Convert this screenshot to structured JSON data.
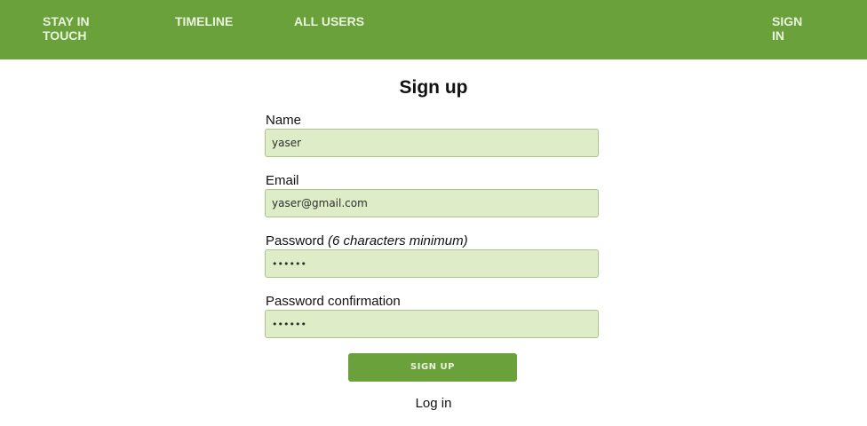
{
  "header": {
    "brand": "STAY IN TOUCH",
    "nav": {
      "timeline": "TIMELINE",
      "all_users": "ALL USERS",
      "sign_in": "SIGN IN"
    },
    "colors": {
      "bar": "#6aa13a",
      "link": "#e9f3df"
    }
  },
  "form": {
    "title": "Sign up",
    "name": {
      "label": "Name",
      "value": "yaser"
    },
    "email": {
      "label": "Email",
      "value": "yaser@gmail.com"
    },
    "password": {
      "label": "Password",
      "hint": "(6 characters minimum)",
      "value": "••••••"
    },
    "password_confirmation": {
      "label": "Password confirmation",
      "value": "••••••"
    },
    "submit_label": "SIGN UP",
    "login_link": "Log in",
    "colors": {
      "input_bg": "#deedc8",
      "button_bg": "#6aa13a"
    }
  }
}
